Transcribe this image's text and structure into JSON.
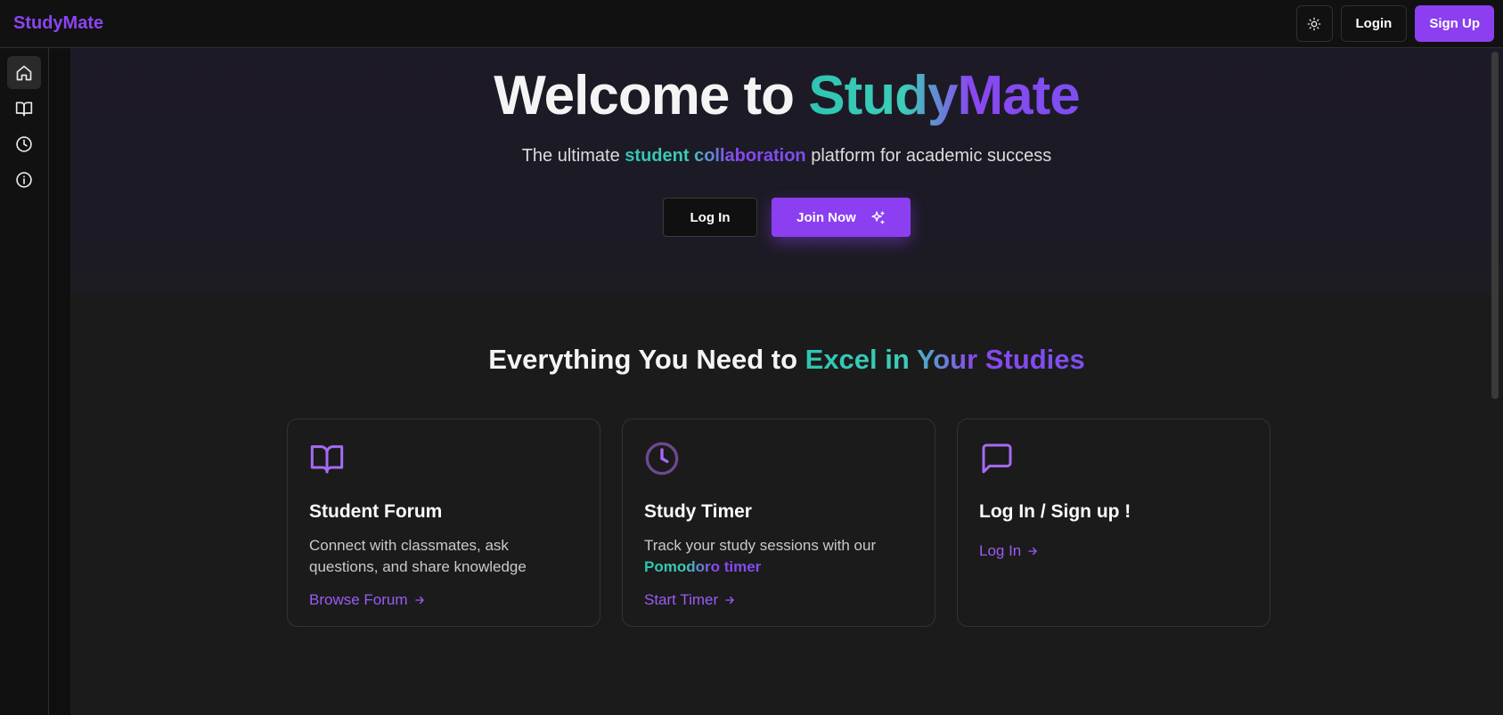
{
  "header": {
    "brand": "StudyMate",
    "theme_toggle_icon": "sun-icon",
    "login_label": "Login",
    "signup_label": "Sign Up"
  },
  "sidebar": {
    "items": [
      {
        "icon": "home-icon",
        "active": true
      },
      {
        "icon": "book-open-icon",
        "active": false
      },
      {
        "icon": "clock-icon",
        "active": false
      },
      {
        "icon": "info-icon",
        "active": false
      }
    ]
  },
  "hero": {
    "title_plain": "Welcome to ",
    "title_highlight": "StudyMate",
    "subtitle_before": "The ultimate ",
    "subtitle_highlight": "student collaboration",
    "subtitle_after": " platform for academic success",
    "login_button": "Log In",
    "join_button": "Join Now",
    "join_icon": "sparkles-icon"
  },
  "features": {
    "title_plain": "Everything You Need to ",
    "title_highlight": "Excel in Your Studies",
    "cards": [
      {
        "icon": "book-open-icon",
        "title": "Student Forum",
        "description": "Connect with classmates, ask questions, and share knowledge",
        "link": "Browse Forum"
      },
      {
        "icon": "clock-icon",
        "title": "Study Timer",
        "description_plain": "Track your study sessions with our ",
        "description_highlight": "Pomodoro timer",
        "link": "Start Timer"
      },
      {
        "icon": "message-square-icon",
        "title": "Log In / Sign up !",
        "link": "Log In"
      }
    ]
  },
  "colors": {
    "accent": "#8b3ff0",
    "teal": "#2fc4b2",
    "background": "#1b1b1b"
  }
}
